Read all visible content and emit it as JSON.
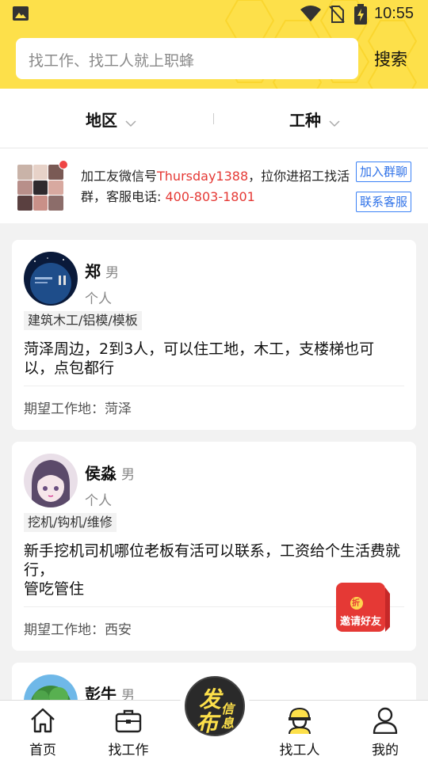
{
  "status_bar": {
    "time": "10:55"
  },
  "search": {
    "placeholder": "找工作、找工人就上职蜂",
    "button": "搜索"
  },
  "filters": {
    "region": "地区",
    "trade": "工种"
  },
  "banner": {
    "text_a": "加工友微信号",
    "wechat": "Thursday1388",
    "text_b": "，拉你进招工找活群，客服电话: ",
    "phone": "400-803-1801",
    "join_button": "加入群聊",
    "contact_button": "联系客服"
  },
  "workers": [
    {
      "name": "郑",
      "gender": "男",
      "role": "个人",
      "tag": "建筑木工/铝模/模板",
      "description": "菏泽周边，2到3人，可以住工地，木工，支楼梯也可以，点包都行",
      "location_label": "期望工作地：",
      "location": "菏泽"
    },
    {
      "name": "侯淼",
      "gender": "男",
      "role": "个人",
      "tag": "挖机/钩机/维修",
      "description": "新手挖机司机哪位老板有活可以联系，工资给个生活费就行，\n管吃管住",
      "location_label": "期望工作地：",
      "location": "西安"
    },
    {
      "name": "彭牛",
      "gender": "男"
    }
  ],
  "invite": {
    "label": "邀请好友",
    "badge": "折"
  },
  "fab": {
    "char1": "发",
    "char2": "布",
    "char3": "信",
    "char4": "息"
  },
  "tabs": [
    {
      "label": "首页",
      "icon": "home-icon"
    },
    {
      "label": "找工作",
      "icon": "briefcase-icon"
    },
    {
      "label": "找工人",
      "icon": "worker-helmet-icon"
    },
    {
      "label": "我的",
      "icon": "person-icon"
    }
  ],
  "colors": {
    "brand_yellow": "#fde04a",
    "highlight_red": "#e53935",
    "link_blue": "#2f72e8"
  }
}
